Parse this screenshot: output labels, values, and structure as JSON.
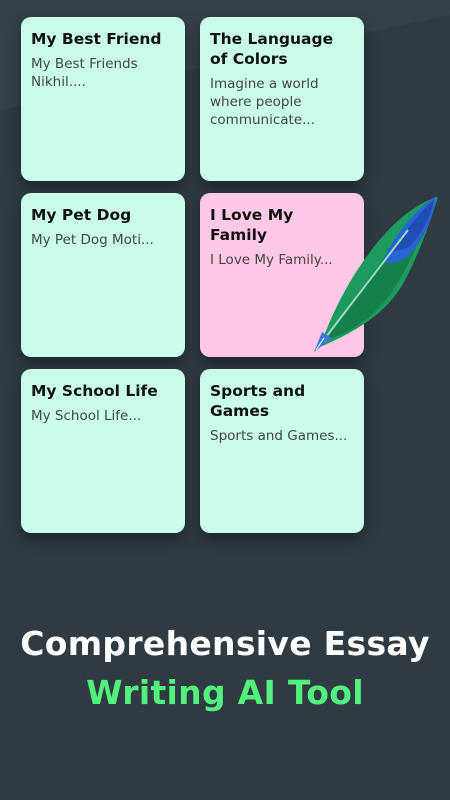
{
  "cards": [
    {
      "title": "My Best Friend",
      "text": "My Best Friends Nikhil...."
    },
    {
      "title": "The Language of Colors",
      "text": "Imagine a world where people communicate..."
    },
    {
      "title": "My Pet Dog",
      "text": "My Pet Dog Moti..."
    },
    {
      "title": "I Love My Family",
      "text": "I Love My Family..."
    },
    {
      "title": "My School Life",
      "text": "My School Life..."
    },
    {
      "title": "Sports and Games",
      "text": "Sports and Games..."
    }
  ],
  "headline": {
    "line1": "Comprehensive Essay",
    "line2": "Writing AI Tool"
  },
  "colors": {
    "background": "#2f3a42",
    "card_mint": "#c9fdea",
    "card_pink": "#ffc8e6",
    "accent_green": "#52f07d",
    "feather_green": "#1d9a5e",
    "feather_blue": "#2a63d8"
  },
  "icons": {
    "feather": "quill-feather-icon"
  }
}
